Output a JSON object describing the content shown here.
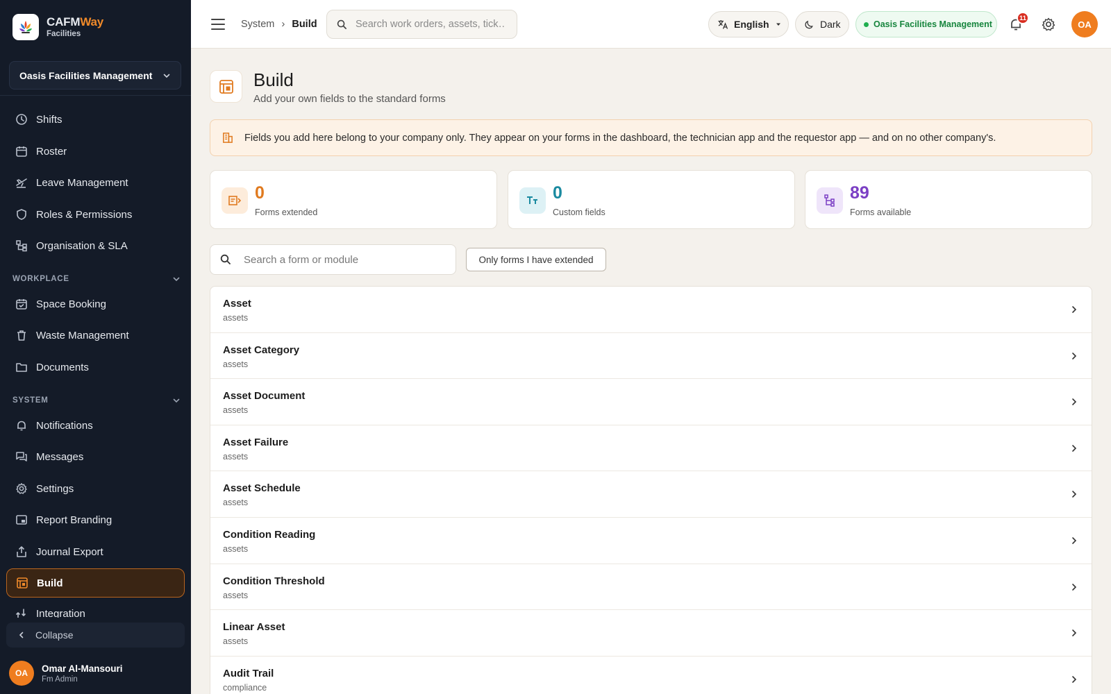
{
  "brand": {
    "name_main": "CAFM",
    "name_accent": "Way",
    "sub": "Facilities"
  },
  "org_selector": {
    "value": "Oasis Facilities Management"
  },
  "sidebar": {
    "items_top": [
      {
        "label": "Shifts",
        "icon": "clock-icon"
      },
      {
        "label": "Roster",
        "icon": "calendar-icon"
      },
      {
        "label": "Leave Management",
        "icon": "plane-icon"
      },
      {
        "label": "Roles & Permissions",
        "icon": "shield-icon"
      },
      {
        "label": "Organisation & SLA",
        "icon": "org-chart-icon"
      }
    ],
    "section_workplace": "WORKPLACE",
    "items_workplace": [
      {
        "label": "Space Booking",
        "icon": "calendar-check-icon"
      },
      {
        "label": "Waste Management",
        "icon": "trash-icon"
      },
      {
        "label": "Documents",
        "icon": "folder-icon"
      }
    ],
    "section_system": "SYSTEM",
    "items_system": [
      {
        "label": "Notifications",
        "icon": "bell-icon"
      },
      {
        "label": "Messages",
        "icon": "chat-icon"
      },
      {
        "label": "Settings",
        "icon": "gear-icon"
      },
      {
        "label": "Report Branding",
        "icon": "branding-icon"
      },
      {
        "label": "Journal Export",
        "icon": "export-icon"
      },
      {
        "label": "Build",
        "icon": "build-icon",
        "active": true
      },
      {
        "label": "Integration",
        "icon": "integration-icon"
      }
    ],
    "collapse_label": "Collapse",
    "user": {
      "initials": "OA",
      "name": "Omar Al-Mansouri",
      "role": "Fm Admin"
    }
  },
  "topbar": {
    "breadcrumb": [
      "System",
      "Build"
    ],
    "search_placeholder": "Search work orders, assets, tick…",
    "language": "English",
    "theme": "Dark",
    "org_pill": "Oasis Facilities Management",
    "notification_count": "11",
    "avatar_initials": "OA"
  },
  "page": {
    "title": "Build",
    "subtitle": "Add your own fields to the standard forms",
    "banner": "Fields you add here belong to your company only. They appear on your forms in the dashboard, the technician app and the requestor app — and on no other company's."
  },
  "stats": [
    {
      "value": "0",
      "label": "Forms extended",
      "color": "#e07a1f",
      "icon": "form-extend-icon"
    },
    {
      "value": "0",
      "label": "Custom fields",
      "color": "#1a8aa0",
      "icon": "text-field-icon"
    },
    {
      "value": "89",
      "label": "Forms available",
      "color": "#7b3fc4",
      "icon": "hierarchy-icon"
    }
  ],
  "form_search": {
    "placeholder": "Search a form or module"
  },
  "filter_button": "Only forms I have extended",
  "forms": [
    {
      "name": "Asset",
      "module": "assets"
    },
    {
      "name": "Asset Category",
      "module": "assets"
    },
    {
      "name": "Asset Document",
      "module": "assets"
    },
    {
      "name": "Asset Failure",
      "module": "assets"
    },
    {
      "name": "Asset Schedule",
      "module": "assets"
    },
    {
      "name": "Condition Reading",
      "module": "assets"
    },
    {
      "name": "Condition Threshold",
      "module": "assets"
    },
    {
      "name": "Linear Asset",
      "module": "assets"
    },
    {
      "name": "Audit Trail",
      "module": "compliance"
    }
  ],
  "colors": {
    "accent": "#ef7d1f",
    "sidebar_bg": "#141b28",
    "page_bg": "#f4f1ec"
  }
}
